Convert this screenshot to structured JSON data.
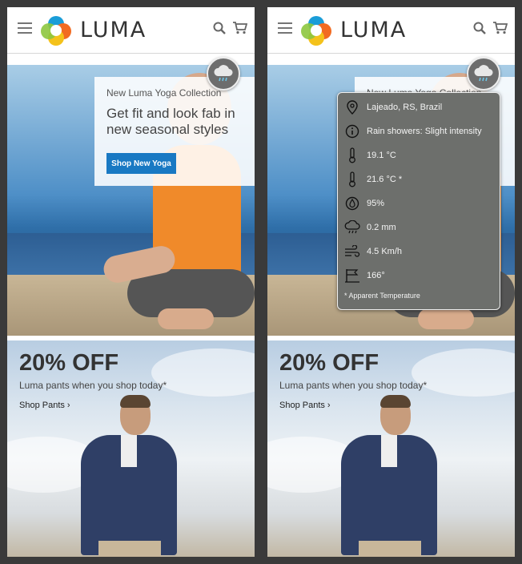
{
  "header": {
    "logo_text": "LUMA"
  },
  "hero": {
    "collection_label": "New Luma Yoga Collection",
    "headline": "Get fit and look fab in new seasonal styles",
    "button_label": "Shop New Yoga"
  },
  "banner2": {
    "title": "20% OFF",
    "subtitle": "Luma pants when you shop today*",
    "link_label": "Shop Pants ›"
  },
  "weather": {
    "location": "Lajeado, RS, Brazil",
    "condition": "Rain showers: Slight intensity",
    "temperature": "19.1 °C",
    "apparent_temperature": "21.6 °C *",
    "humidity": "95%",
    "precipitation": "0.2 mm",
    "wind_speed": "4.5 Km/h",
    "wind_direction": "166°",
    "footnote": "* Apparent Temperature",
    "icons": [
      "location-pin-icon",
      "info-icon",
      "thermometer-icon",
      "thermometer-icon",
      "humidity-icon",
      "rain-cloud-icon",
      "wind-icon",
      "wind-direction-icon"
    ]
  },
  "colors": {
    "primary_button": "#1979c3",
    "popup_bg": "#6d6f6c"
  }
}
